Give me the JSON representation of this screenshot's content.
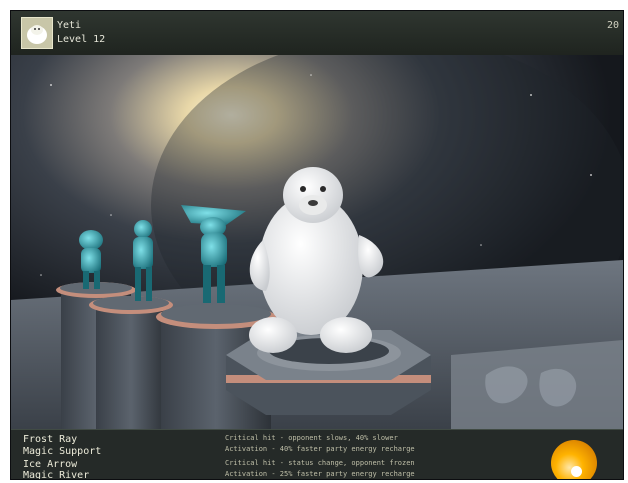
{
  "header": {
    "character_name": "Yeti",
    "level_text": "Level 12",
    "corner_number": "20"
  },
  "skills": [
    {
      "name": "Frost Ray",
      "type": "Magic Support",
      "effect_line1": "Critical hit - opponent slows, 40% slower",
      "effect_line2": "Activation - 40% faster party energy recharge"
    },
    {
      "name": "Ice Arrow",
      "type": "Magic River",
      "effect_line1": "Critical hit - status change, opponent frozen",
      "effect_line2": "Activation - 25% faster party energy recharge"
    }
  ],
  "colors": {
    "accent_orb": "#ffb300",
    "panel_text": "#ecebd9"
  },
  "icons": {
    "character_portrait": "yeti-portrait-icon",
    "action_orb": "energy-orb-icon"
  }
}
